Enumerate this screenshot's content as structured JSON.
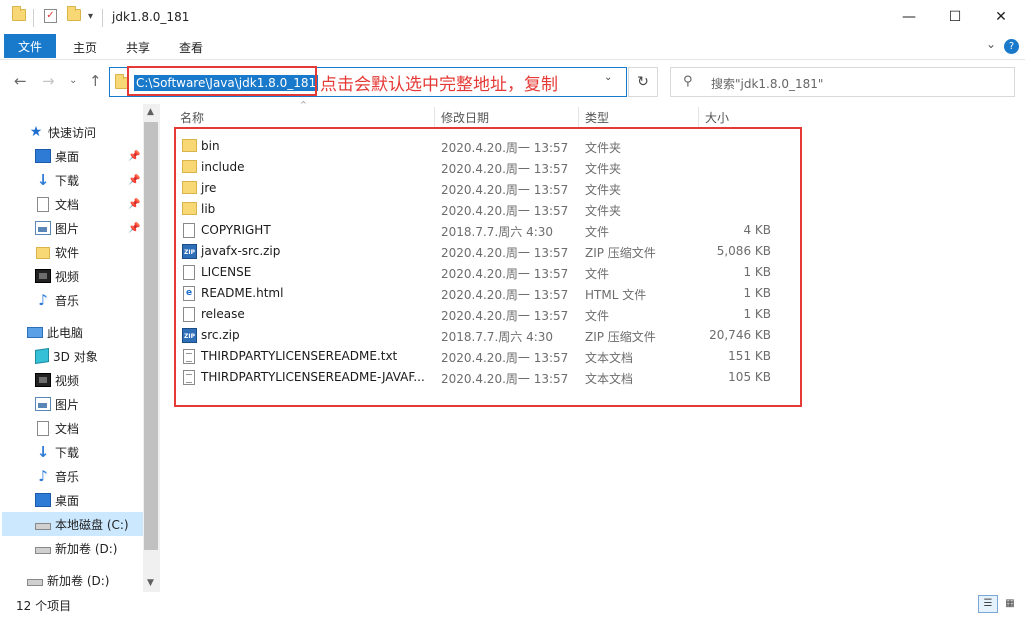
{
  "window": {
    "title": "jdk1.8.0_181",
    "minimize": "—",
    "maximize": "☐",
    "close": "✕",
    "quickaccess_dropdown": "▾"
  },
  "ribbon": {
    "tabs": [
      "文件",
      "主页",
      "共享",
      "查看"
    ],
    "collapse": "⌄",
    "help": "?"
  },
  "address": {
    "path": "C:\\Software\\Java\\jdk1.8.0_181",
    "annotation": "点击会默认选中完整地址，复制",
    "dropdown": "⌄",
    "refresh": "↻"
  },
  "search": {
    "placeholder": "搜索\"jdk1.8.0_181\"",
    "icon": "search-icon"
  },
  "nav_buttons": {
    "back": "←",
    "forward": "→",
    "recent": "⌄",
    "up": "↑"
  },
  "sidebar": {
    "items": [
      {
        "label": "快速访问",
        "icon": "star-icon"
      },
      {
        "label": "桌面",
        "icon": "desktop-icon",
        "pinned": true
      },
      {
        "label": "下载",
        "icon": "download-icon",
        "pinned": true
      },
      {
        "label": "文档",
        "icon": "document-icon",
        "pinned": true
      },
      {
        "label": "图片",
        "icon": "picture-icon",
        "pinned": true
      },
      {
        "label": "软件",
        "icon": "folder-icon"
      },
      {
        "label": "视频",
        "icon": "video-icon"
      },
      {
        "label": "音乐",
        "icon": "music-icon"
      },
      {
        "label": "此电脑",
        "icon": "pc-icon"
      },
      {
        "label": "3D 对象",
        "icon": "3d-objects-icon"
      },
      {
        "label": "视频",
        "icon": "video-icon"
      },
      {
        "label": "图片",
        "icon": "picture-icon"
      },
      {
        "label": "文档",
        "icon": "document-icon"
      },
      {
        "label": "下载",
        "icon": "download-icon"
      },
      {
        "label": "音乐",
        "icon": "music-icon"
      },
      {
        "label": "桌面",
        "icon": "desktop-icon"
      },
      {
        "label": "本地磁盘 (C:)",
        "icon": "drive-icon",
        "selected": true
      },
      {
        "label": "新加卷 (D:)",
        "icon": "drive-icon"
      },
      {
        "label": "新加卷 (D:)",
        "icon": "drive-icon"
      }
    ]
  },
  "columns": [
    "名称",
    "修改日期",
    "类型",
    "大小"
  ],
  "files": [
    {
      "name": "bin",
      "date": "2020.4.20.周一 13:57",
      "type": "文件夹",
      "size": "",
      "icon": "folder"
    },
    {
      "name": "include",
      "date": "2020.4.20.周一 13:57",
      "type": "文件夹",
      "size": "",
      "icon": "folder"
    },
    {
      "name": "jre",
      "date": "2020.4.20.周一 13:57",
      "type": "文件夹",
      "size": "",
      "icon": "folder"
    },
    {
      "name": "lib",
      "date": "2020.4.20.周一 13:57",
      "type": "文件夹",
      "size": "",
      "icon": "folder"
    },
    {
      "name": "COPYRIGHT",
      "date": "2018.7.7.周六 4:30",
      "type": "文件",
      "size": "4 KB",
      "icon": "file"
    },
    {
      "name": "javafx-src.zip",
      "date": "2020.4.20.周一 13:57",
      "type": "ZIP 压缩文件",
      "size": "5,086 KB",
      "icon": "zip"
    },
    {
      "name": "LICENSE",
      "date": "2020.4.20.周一 13:57",
      "type": "文件",
      "size": "1 KB",
      "icon": "file"
    },
    {
      "name": "README.html",
      "date": "2020.4.20.周一 13:57",
      "type": "HTML 文件",
      "size": "1 KB",
      "icon": "html"
    },
    {
      "name": "release",
      "date": "2020.4.20.周一 13:57",
      "type": "文件",
      "size": "1 KB",
      "icon": "file"
    },
    {
      "name": "src.zip",
      "date": "2018.7.7.周六 4:30",
      "type": "ZIP 压缩文件",
      "size": "20,746 KB",
      "icon": "zip"
    },
    {
      "name": "THIRDPARTYLICENSEREADME.txt",
      "date": "2020.4.20.周一 13:57",
      "type": "文本文档",
      "size": "151 KB",
      "icon": "txt"
    },
    {
      "name": "THIRDPARTYLICENSEREADME-JAVAF...",
      "date": "2020.4.20.周一 13:57",
      "type": "文本文档",
      "size": "105 KB",
      "icon": "txt"
    }
  ],
  "status": {
    "item_count": "12 个项目"
  },
  "colors": {
    "accent": "#1979ca",
    "highlight": "#e53935",
    "selected": "#cce8ff"
  }
}
